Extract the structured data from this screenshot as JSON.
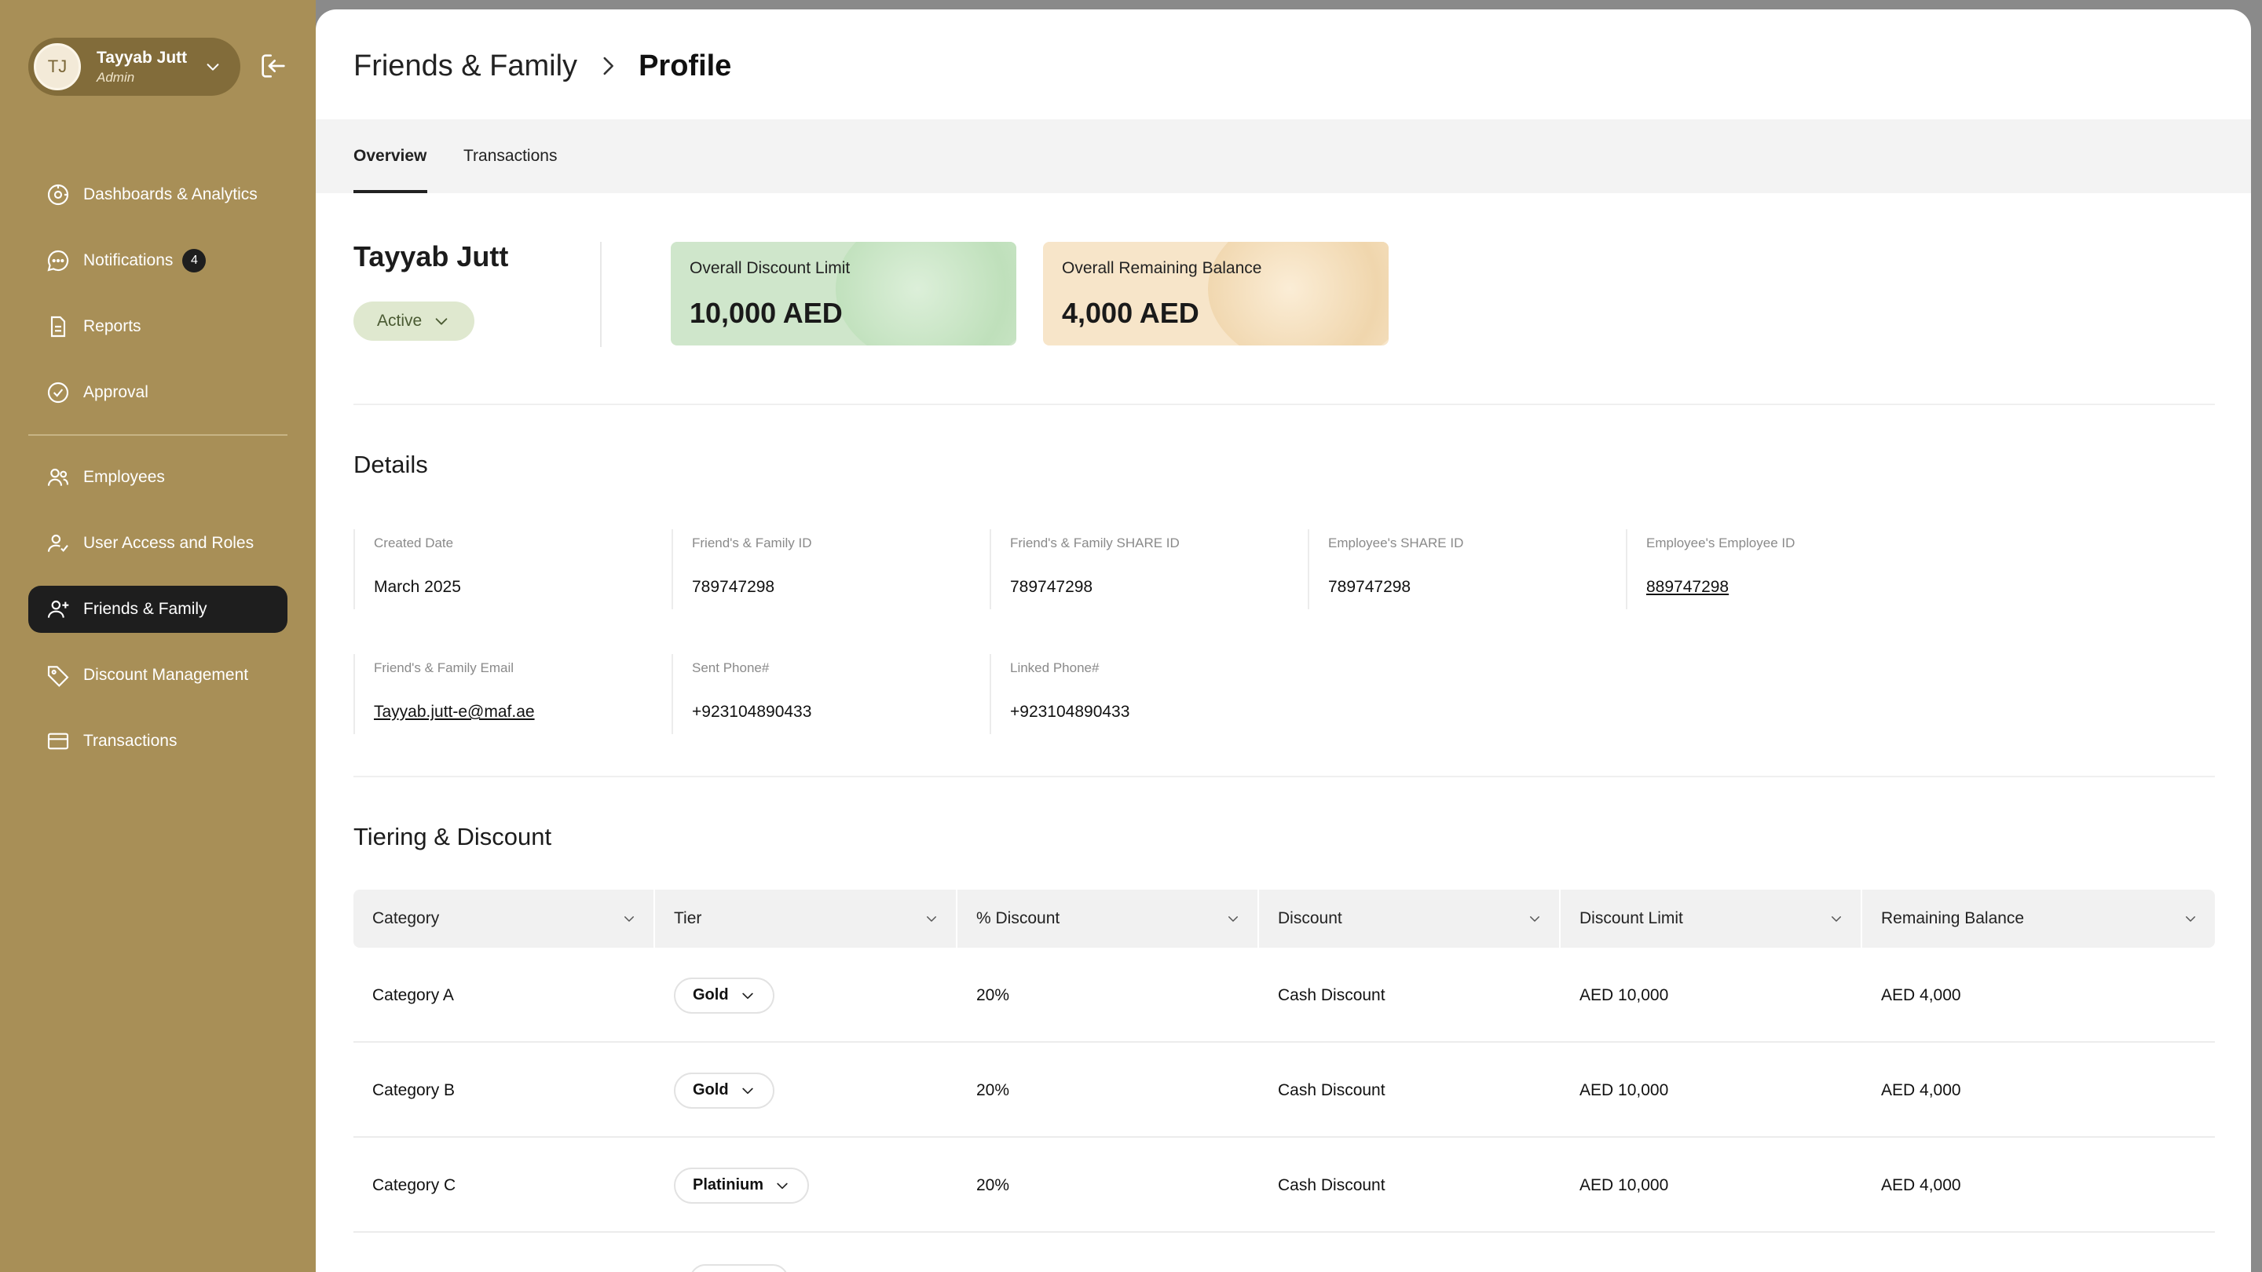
{
  "user": {
    "initials": "TJ",
    "name": "Tayyab Jutt",
    "role": "Admin"
  },
  "sidebar": {
    "items": [
      {
        "label": "Dashboards & Analytics",
        "icon": "dashboard-icon"
      },
      {
        "label": "Notifications",
        "icon": "chat-icon",
        "badge": "4"
      },
      {
        "label": "Reports",
        "icon": "document-icon"
      },
      {
        "label": "Approval",
        "icon": "check-circle-icon"
      },
      {
        "label": "Employees",
        "icon": "users-icon"
      },
      {
        "label": "User Access and Roles",
        "icon": "user-check-icon"
      },
      {
        "label": "Friends & Family",
        "icon": "user-plus-icon",
        "active": true
      },
      {
        "label": "Discount Management",
        "icon": "tag-icon"
      },
      {
        "label": "Transactions",
        "icon": "card-icon"
      }
    ]
  },
  "breadcrumb": {
    "parent": "Friends & Family",
    "current": "Profile"
  },
  "tabs": [
    {
      "label": "Overview",
      "active": true
    },
    {
      "label": "Transactions",
      "active": false
    }
  ],
  "profile": {
    "name": "Tayyab Jutt",
    "status": "Active"
  },
  "kpis": [
    {
      "label": "Overall Discount Limit",
      "value": "10,000 AED",
      "color": "#cfe6cb"
    },
    {
      "label": "Overall Remaining Balance",
      "value": "4,000 AED",
      "color": "#f7e5c9"
    }
  ],
  "details": {
    "title": "Details",
    "fields": [
      {
        "label": "Created Date",
        "value": "March 2025"
      },
      {
        "label": "Friend's & Family ID",
        "value": "789747298"
      },
      {
        "label": "Friend's & Family SHARE ID",
        "value": "789747298"
      },
      {
        "label": "Employee's SHARE ID",
        "value": "789747298"
      },
      {
        "label": "Employee's  Employee ID",
        "value": "889747298",
        "link": true
      },
      {
        "label": "Friend's & Family Email",
        "value": "Tayyab.jutt-e@maf.ae",
        "link": true
      },
      {
        "label": "Sent Phone#",
        "value": "+923104890433"
      },
      {
        "label": "Linked Phone#",
        "value": "+923104890433"
      }
    ]
  },
  "tiering": {
    "title": "Tiering & Discount",
    "columns": [
      "Category",
      "Tier",
      "% Discount",
      "Discount",
      "Discount Limit",
      "Remaining Balance"
    ],
    "rows": [
      {
        "category": "Category A",
        "tier": "Gold",
        "percent": "20%",
        "discount": "Cash Discount",
        "limit": "AED 10,000",
        "remaining": "AED 4,000"
      },
      {
        "category": "Category B",
        "tier": "Gold",
        "percent": "20%",
        "discount": "Cash Discount",
        "limit": "AED 10,000",
        "remaining": "AED 4,000"
      },
      {
        "category": "Category C",
        "tier": "Platinium",
        "percent": "20%",
        "discount": "Cash Discount",
        "limit": "AED 10,000",
        "remaining": "AED 4,000"
      }
    ]
  },
  "colors": {
    "sidebar": "#a88f57",
    "active_nav": "#1e1e1e",
    "status_pill": "#dfe8cf"
  }
}
